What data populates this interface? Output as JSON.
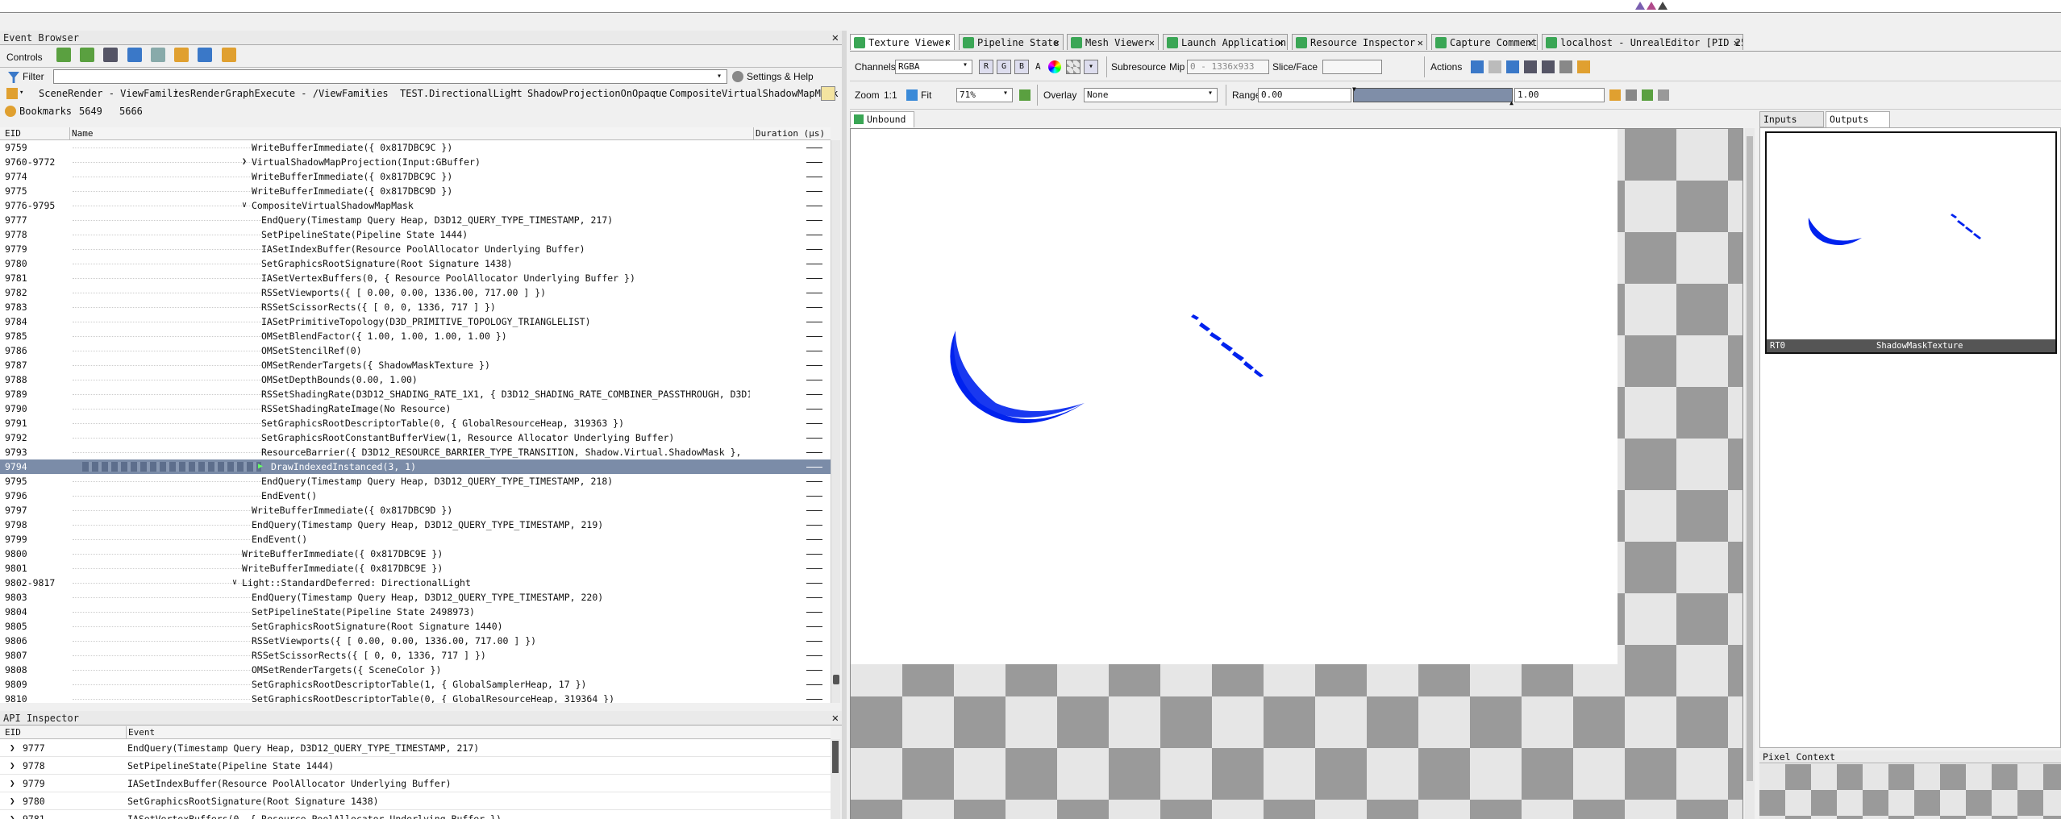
{
  "event_browser": {
    "title": "Event Browser",
    "controls_label": "Controls",
    "filter_label": "Filter",
    "filter_value": "",
    "settings_help": "Settings & Help",
    "breadcrumbs": [
      "SceneRender - ViewFamilies",
      "RenderGraphExecute - /ViewFamilies",
      "TEST.DirectionalLight",
      "ShadowProjectionOnOpaque",
      "CompositeVirtualShadowMapMask"
    ],
    "bookmarks_label": "Bookmarks",
    "bookmarks": [
      "5649",
      "5666"
    ],
    "columns": {
      "eid": "EID",
      "name": "Name",
      "duration": "Duration (µs)"
    },
    "rows": [
      {
        "eid": "9759",
        "name": "WriteBufferImmediate({ 0x817DBC9C })",
        "indent": 1
      },
      {
        "eid": "9760-9772",
        "name": "VirtualShadowMapProjection(Input:GBuffer)",
        "indent": 1,
        "expand": "❯"
      },
      {
        "eid": "9774",
        "name": "WriteBufferImmediate({ 0x817DBC9C })",
        "indent": 1
      },
      {
        "eid": "9775",
        "name": "WriteBufferImmediate({ 0x817DBC9D })",
        "indent": 1
      },
      {
        "eid": "9776-9795",
        "name": "CompositeVirtualShadowMapMask",
        "indent": 1,
        "expand": "∨"
      },
      {
        "eid": "9777",
        "name": "EndQuery(Timestamp Query Heap, D3D12_QUERY_TYPE_TIMESTAMP, 217)",
        "indent": 2
      },
      {
        "eid": "9778",
        "name": "SetPipelineState(Pipeline State 1444)",
        "indent": 2
      },
      {
        "eid": "9779",
        "name": "IASetIndexBuffer(Resource PoolAllocator Underlying Buffer)",
        "indent": 2
      },
      {
        "eid": "9780",
        "name": "SetGraphicsRootSignature(Root Signature 1438)",
        "indent": 2
      },
      {
        "eid": "9781",
        "name": "IASetVertexBuffers(0, { Resource PoolAllocator Underlying Buffer })",
        "indent": 2
      },
      {
        "eid": "9782",
        "name": "RSSetViewports({ [ 0.00, 0.00, 1336.00, 717.00 ] })",
        "indent": 2
      },
      {
        "eid": "9783",
        "name": "RSSetScissorRects({ [ 0, 0, 1336, 717 ] })",
        "indent": 2
      },
      {
        "eid": "9784",
        "name": "IASetPrimitiveTopology(D3D_PRIMITIVE_TOPOLOGY_TRIANGLELIST)",
        "indent": 2
      },
      {
        "eid": "9785",
        "name": "OMSetBlendFactor({ 1.00, 1.00, 1.00, 1.00 })",
        "indent": 2
      },
      {
        "eid": "9786",
        "name": "OMSetStencilRef(0)",
        "indent": 2
      },
      {
        "eid": "9787",
        "name": "OMSetRenderTargets({ ShadowMaskTexture })",
        "indent": 2
      },
      {
        "eid": "9788",
        "name": "OMSetDepthBounds(0.00, 1.00)",
        "indent": 2
      },
      {
        "eid": "9789",
        "name": "RSSetShadingRate(D3D12_SHADING_RATE_1X1, { D3D12_SHADING_RATE_COMBINER_PASSTHROUGH, D3D12_SHADING_…",
        "indent": 2
      },
      {
        "eid": "9790",
        "name": "RSSetShadingRateImage(No Resource)",
        "indent": 2
      },
      {
        "eid": "9791",
        "name": "SetGraphicsRootDescriptorTable(0, { GlobalResourceHeap, 319363 })",
        "indent": 2
      },
      {
        "eid": "9792",
        "name": "SetGraphicsRootConstantBufferView(1, Resource Allocator Underlying Buffer)",
        "indent": 2
      },
      {
        "eid": "9793",
        "name": "ResourceBarrier({ D3D12_RESOURCE_BARRIER_TYPE_TRANSITION, Shadow.Virtual.ShadowMask },",
        "indent": 2
      },
      {
        "eid": "9794",
        "name": "DrawIndexedInstanced(3, 1)",
        "indent": 2,
        "selected": true
      },
      {
        "eid": "9795",
        "name": "EndQuery(Timestamp Query Heap, D3D12_QUERY_TYPE_TIMESTAMP, 218)",
        "indent": 2
      },
      {
        "eid": "9796",
        "name": "EndEvent()",
        "indent": 2
      },
      {
        "eid": "9797",
        "name": "WriteBufferImmediate({ 0x817DBC9D })",
        "indent": 1
      },
      {
        "eid": "9798",
        "name": "EndQuery(Timestamp Query Heap, D3D12_QUERY_TYPE_TIMESTAMP, 219)",
        "indent": 1
      },
      {
        "eid": "9799",
        "name": "EndEvent()",
        "indent": 1
      },
      {
        "eid": "9800",
        "name": "WriteBufferImmediate({ 0x817DBC9E })",
        "indent": 0
      },
      {
        "eid": "9801",
        "name": "WriteBufferImmediate({ 0x817DBC9E })",
        "indent": 0
      },
      {
        "eid": "9802-9817",
        "name": "Light::StandardDeferred: DirectionalLight",
        "indent": 0,
        "expand": "∨"
      },
      {
        "eid": "9803",
        "name": "EndQuery(Timestamp Query Heap, D3D12_QUERY_TYPE_TIMESTAMP, 220)",
        "indent": 1
      },
      {
        "eid": "9804",
        "name": "SetPipelineState(Pipeline State 2498973)",
        "indent": 1
      },
      {
        "eid": "9805",
        "name": "SetGraphicsRootSignature(Root Signature 1440)",
        "indent": 1
      },
      {
        "eid": "9806",
        "name": "RSSetViewports({ [ 0.00, 0.00, 1336.00, 717.00 ] })",
        "indent": 1
      },
      {
        "eid": "9807",
        "name": "RSSetScissorRects({ [ 0, 0, 1336, 717 ] })",
        "indent": 1
      },
      {
        "eid": "9808",
        "name": "OMSetRenderTargets({ SceneColor })",
        "indent": 1
      },
      {
        "eid": "9809",
        "name": "SetGraphicsRootDescriptorTable(1, { GlobalSamplerHeap, 17 })",
        "indent": 1
      },
      {
        "eid": "9810",
        "name": "SetGraphicsRootDescriptorTable(0, { GlobalResourceHeap, 319364 })",
        "indent": 1
      }
    ]
  },
  "api_inspector": {
    "title": "API Inspector",
    "columns": {
      "eid": "EID",
      "event": "Event"
    },
    "rows": [
      {
        "eid": "9777",
        "event": "EndQuery(Timestamp Query Heap, D3D12_QUERY_TYPE_TIMESTAMP, 217)"
      },
      {
        "eid": "9778",
        "event": "SetPipelineState(Pipeline State 1444)"
      },
      {
        "eid": "9779",
        "event": "IASetIndexBuffer(Resource PoolAllocator Underlying Buffer)"
      },
      {
        "eid": "9780",
        "event": "SetGraphicsRootSignature(Root Signature 1438)"
      },
      {
        "eid": "9781",
        "event": "IASetVertexBuffers(0, { Resource PoolAllocator Underlying Buffer })"
      }
    ]
  },
  "tabs": [
    {
      "label": "Texture Viewer",
      "active": true
    },
    {
      "label": "Pipeline State"
    },
    {
      "label": "Mesh Viewer"
    },
    {
      "label": "Launch Application"
    },
    {
      "label": "Resource Inspector"
    },
    {
      "label": "Capture Comments"
    },
    {
      "label": "localhost - UnrealEditor [PID 251…"
    }
  ],
  "texture_viewer": {
    "channels_label": "Channels",
    "channels_value": "RGBA",
    "rgb_buttons": [
      "R",
      "G",
      "B"
    ],
    "alpha_label": "A",
    "subresource_label": "Subresource",
    "mip_label": "Mip",
    "mip_value": "0 - 1336x933",
    "slice_label": "Slice/Face",
    "slice_value": "",
    "actions_label": "Actions",
    "zoom_label": "Zoom",
    "zoom_ratio": "1:1",
    "fit_label": "Fit",
    "zoom_value": "71%",
    "overlay_label": "Overlay",
    "overlay_value": "None",
    "range_label": "Range",
    "range_min": "0.00",
    "range_max": "1.00",
    "sub_tab": "Unbound"
  },
  "right_panel": {
    "tabs": [
      "Inputs",
      "Outputs"
    ],
    "active_tab": "Outputs",
    "thumb_slot": "RT0",
    "thumb_name": "ShadowMaskTexture",
    "pixel_context_title": "Pixel Context"
  },
  "colors": {
    "selection": "#7b8ca8",
    "shadow_blue": "#0022ee",
    "tab_icon": "#3aa655"
  }
}
